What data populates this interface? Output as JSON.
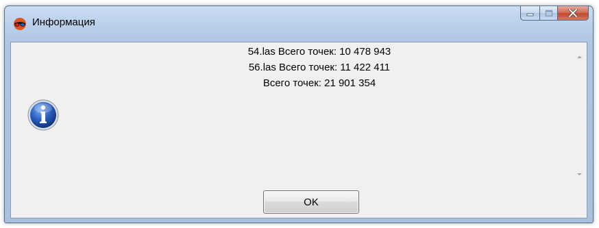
{
  "window": {
    "title": "Информация",
    "title_icon": "3d-glasses-icon"
  },
  "caption_buttons": {
    "minimize_icon": "minimize-icon",
    "maximize_icon": "maximize-icon",
    "close_icon": "close-icon"
  },
  "message": {
    "icon": "info-icon",
    "lines": [
      "54.las Всего точек: 10 478 943",
      "56.las Всего точек: 11 422 411",
      "Всего точек: 21 901 354"
    ]
  },
  "buttons": {
    "ok_label": "OK"
  },
  "colors": {
    "close_button": "#c14a2f",
    "info_icon": "#1f4fa8",
    "title_bar": "#b9cfe9"
  }
}
